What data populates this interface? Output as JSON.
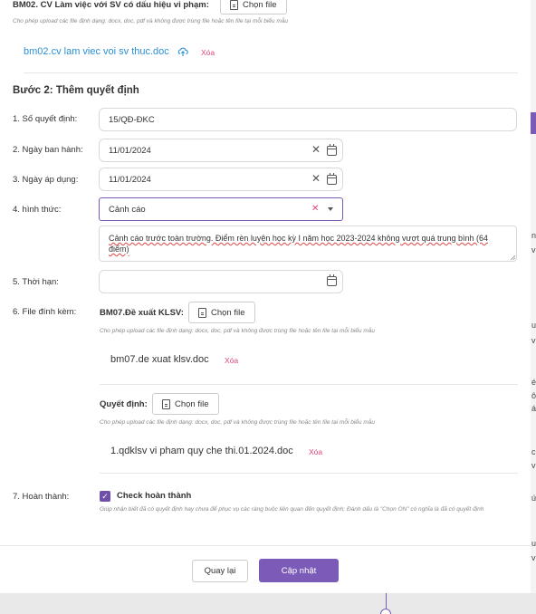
{
  "bm02": {
    "label": "BM02. CV Làm việc với SV có dấu hiệu vi phạm:",
    "choose_button": "Chọn file",
    "hint": "Cho phép upload các file định dạng: docx, doc, pdf và không được trùng file hoặc tên file tại mỗi biểu mẫu",
    "file_name": "bm02.cv lam viec voi sv thuc.doc",
    "delete_label": "Xóa",
    "upload_icon": "cloud-upload-icon"
  },
  "step2": {
    "title": "Bước 2: Thêm quyết định"
  },
  "form": {
    "decision_no_label": "1. Số quyết định:",
    "decision_no_value": "15/QĐ-ĐKC",
    "issue_date_label": "2. Ngày ban hành:",
    "issue_date_value": "11/01/2024",
    "apply_date_label": "3. Ngày áp dụng:",
    "apply_date_value": "11/01/2024",
    "form_label": "4. hình thức:",
    "form_value": "Cảnh cáo",
    "description": "Cảnh cáo trước toàn trường. Điểm rèn luyện học kỳ I năm học 2023-2024 không vượt quá trung bình (64 điểm)",
    "duration_label": "5. Thời hạn:",
    "duration_value": "",
    "attachments_label": "6. File đính kèm:"
  },
  "bm07": {
    "label": "BM07.Đề xuất KLSV:",
    "choose_button": "Chọn file",
    "hint": "Cho phép upload các file định dạng: docx, doc, pdf và không được trùng file hoặc tên file tại mỗi biểu mẫu",
    "file_name": "bm07.de xuat klsv.doc",
    "delete_label": "Xóa"
  },
  "decision_file": {
    "label": "Quyết định:",
    "choose_button": "Chọn file",
    "hint": "Cho phép upload các file định dạng: docx, doc, pdf và không được trùng file hoặc tên file tại mỗi biểu mẫu",
    "file_name": "1.qdklsv vi pham quy che thi.01.2024.doc",
    "delete_label": "Xóa"
  },
  "complete": {
    "label": "7. Hoàn thành:",
    "checkbox_label": "Check hoàn thành",
    "checked": true,
    "hint": "Giúp nhận biết đã có quyết định hay chưa để phục vụ các ràng buộc liên quan đến quyết định; Đánh dấu là \"Chọn ON\" có nghĩa là đã có quyết định"
  },
  "footer": {
    "back_label": "Quay lại",
    "update_label": "Cập nhật"
  },
  "background": {
    "fragments": [
      "ng",
      "vi",
      "u",
      "vi",
      "é",
      "ôi",
      "ác",
      "ch",
      "vi",
      "ức",
      "u",
      "vi"
    ]
  },
  "colors": {
    "accent": "#7b5bb7",
    "link": "#2b8fd6",
    "delete": "#e0457b",
    "focus_border": "#7b5bb7"
  }
}
